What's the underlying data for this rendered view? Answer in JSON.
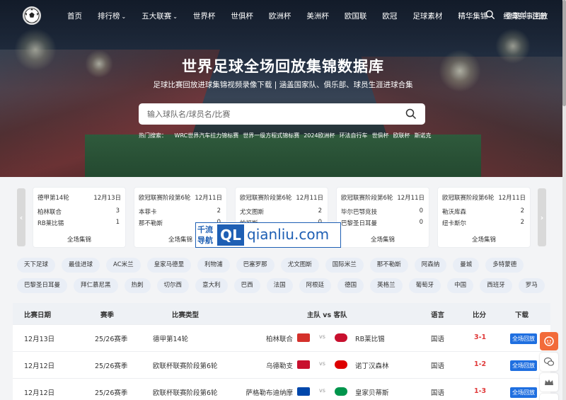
{
  "nav": {
    "items": [
      {
        "label": "首页",
        "dropdown": false
      },
      {
        "label": "排行榜",
        "dropdown": true
      },
      {
        "label": "五大联赛",
        "dropdown": true
      },
      {
        "label": "世界杯",
        "dropdown": false
      },
      {
        "label": "世俱杯",
        "dropdown": false
      },
      {
        "label": "欧洲杯",
        "dropdown": false
      },
      {
        "label": "美洲杯",
        "dropdown": false
      },
      {
        "label": "欧国联",
        "dropdown": false
      },
      {
        "label": "欧冠",
        "dropdown": false
      },
      {
        "label": "足球素材",
        "dropdown": false
      },
      {
        "label": "精华集锦",
        "dropdown": false
      },
      {
        "label": "经典赛事回放",
        "dropdown": false
      }
    ],
    "login": "登录",
    "separator": "|",
    "register": "注册"
  },
  "hero": {
    "title": "世界足球全场回放集锦数据库",
    "subtitle": "足球比赛回放进球集锦视频录像下载 | 涵盖国家队、俱乐部、球员生涯进球合集",
    "search_placeholder": "输入球队名/球员名/比赛",
    "hot_label": "热门搜索：",
    "hot_items": [
      "WRC世界汽车拉力锦标赛",
      "世界一级方程式锦标赛",
      "2024欧洲杯",
      "环法自行车",
      "世俱杯",
      "欧联杯",
      "斯诺克"
    ]
  },
  "match_cards": [
    {
      "league": "德甲第14轮",
      "date": "12月13日",
      "team1": "柏林联合",
      "score1": "3",
      "team2": "RB莱比锡",
      "score2": "1",
      "highlight": "全场集锦"
    },
    {
      "league": "欧冠联赛阶段第6轮",
      "date": "12月11日",
      "team1": "本菲卡",
      "score1": "2",
      "team2": "那不勒斯",
      "score2": "0",
      "highlight": "全场集锦"
    },
    {
      "league": "欧冠联赛阶段第6轮",
      "date": "12月11日",
      "team1": "尤文图斯",
      "score1": "2",
      "team2": "帕福斯",
      "score2": "0",
      "highlight": "全场集锦"
    },
    {
      "league": "欧冠联赛阶段第6轮",
      "date": "12月11日",
      "team1": "毕尔巴鄂竞技",
      "score1": "0",
      "team2": "巴黎圣日耳曼",
      "score2": "0",
      "highlight": "全场集锦"
    },
    {
      "league": "欧冠联赛阶段第6轮",
      "date": "12月11日",
      "team1": "勒沃库森",
      "score1": "2",
      "team2": "纽卡斯尔",
      "score2": "2",
      "highlight": "全场集锦"
    }
  ],
  "watermark": {
    "cn": "千流导航",
    "ql": "QL",
    "en": "qianliu.com"
  },
  "tags_row1": [
    "天下足球",
    "最佳进球",
    "AC米兰",
    "皇家马德里",
    "利物浦",
    "巴塞罗那",
    "尤文图斯",
    "国际米兰",
    "那不勒斯",
    "阿森纳",
    "曼城",
    "多特蒙德"
  ],
  "tags_row2": [
    "巴黎圣日耳曼",
    "拜仁慕尼黑",
    "热刺",
    "切尔西",
    "意大利",
    "巴西",
    "法国",
    "阿根廷",
    "德国",
    "英格兰",
    "葡萄牙",
    "中国",
    "西班牙",
    "罗马"
  ],
  "table": {
    "headers": {
      "date": "比赛日期",
      "season": "赛季",
      "type": "比赛类型",
      "teams": "主队 vs 客队",
      "lang": "语言",
      "score": "比分",
      "download": "下载"
    },
    "rows": [
      {
        "date": "12月13日",
        "season": "25/26赛季",
        "type": "德甲第14轮",
        "home": "柏林联合",
        "vs": "vs",
        "away": "RB莱比锡",
        "lang": "国语",
        "score": "3-1",
        "download": "全场回放",
        "home_color": "#d4312b",
        "away_color": "#c8102e"
      },
      {
        "date": "12月12日",
        "season": "25/26赛季",
        "type": "欧联杯联赛阶段第6轮",
        "home": "乌德勒支",
        "vs": "vs",
        "away": "诺丁汉森林",
        "lang": "国语",
        "score": "1-2",
        "download": "全场回放",
        "home_color": "#c8102e",
        "away_color": "#dd0000"
      },
      {
        "date": "12月12日",
        "season": "25/26赛季",
        "type": "欧联杯联赛阶段第6轮",
        "home": "萨格勒布迪纳摩",
        "vs": "vs",
        "away": "皇家贝蒂斯",
        "lang": "国语",
        "score": "1-3",
        "download": "全场回放",
        "home_color": "#0047ab",
        "away_color": "#00954c"
      }
    ]
  }
}
